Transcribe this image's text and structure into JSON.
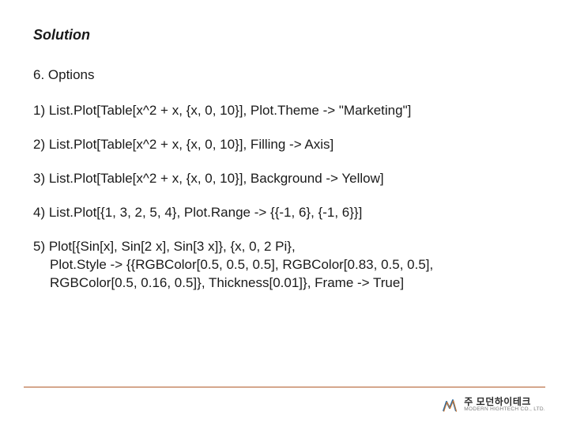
{
  "title": "Solution",
  "section": "6. Options",
  "items": [
    {
      "line1": "1) List.Plot[Table[x^2 + x, {x, 0, 10}], Plot.Theme -> \"Marketing\"]"
    },
    {
      "line1": "2) List.Plot[Table[x^2 + x, {x, 0, 10}], Filling -> Axis]"
    },
    {
      "line1": "3) List.Plot[Table[x^2 + x, {x, 0, 10}], Background -> Yellow]"
    },
    {
      "line1": "4) List.Plot[{1, 3, 2, 5, 4}, Plot.Range -> {{-1, 6}, {-1, 6}}]"
    },
    {
      "line1": "5) Plot[{Sin[x], Sin[2 x], Sin[3 x]}, {x, 0, 2 Pi},",
      "line2": "Plot.Style -> {{RGBColor[0.5, 0.5, 0.5], RGBColor[0.83, 0.5, 0.5],",
      "line3": "RGBColor[0.5, 0.16, 0.5]}, Thickness[0.01]}, Frame -> True]"
    }
  ],
  "brand": {
    "kr": "주 모던하이테크",
    "en": "MODERN HIGHTECH CO., LTD."
  }
}
